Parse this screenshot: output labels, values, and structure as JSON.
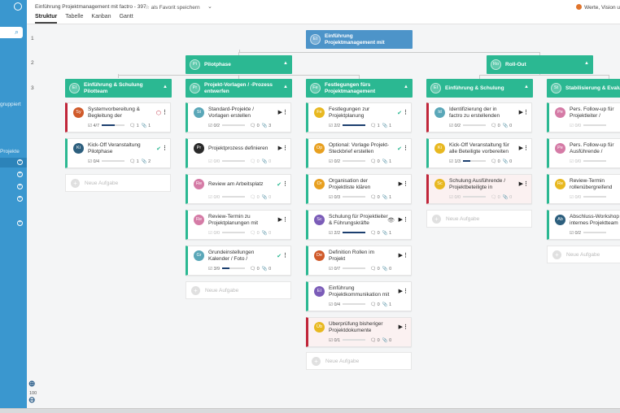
{
  "header": {
    "title": "Einführung Projektmanagement mit factro - 397",
    "favorite_label": "als Favorit speichern",
    "caret": "⌄",
    "tabs": [
      "Struktur",
      "Tabelle",
      "Kanban",
      "Gantt"
    ],
    "user_text": "Werte, Vision u"
  },
  "sidebar": {
    "group_text": "gruppiert",
    "projects_text": "Projekte",
    "zoom_level": "100"
  },
  "rows": [
    "1",
    "2",
    "3"
  ],
  "root": {
    "initials": "EI",
    "label": "Einführung Projektmanagement mit"
  },
  "level2": [
    {
      "initials": "Pi",
      "label": "Pilotphase"
    },
    {
      "initials": "Ro",
      "label": "Roll-Out"
    }
  ],
  "columns": [
    {
      "initials": "EI",
      "label": "Einführung & Schulung Pilotteam"
    },
    {
      "initials": "Pr",
      "label": "Projekt-Vorlagen / -Prozess entwerfen"
    },
    {
      "initials": "Fe",
      "label": "Festlegungen fürs Projektmanagement"
    },
    {
      "initials": "EI",
      "label": "Einführung & Schulung"
    },
    {
      "initials": "St",
      "label": "Stabilisierung & Evalu"
    }
  ],
  "add_task_label": "Neue Aufgabe",
  "colors": {
    "blue": "#4d94c9",
    "green": "#2bb892",
    "red": "#c0263a",
    "sidebar": "#3a97cf"
  },
  "cards": [
    {
      "col": 0,
      "row": 0,
      "av": "Sy",
      "color": "#d05a2a",
      "title": "Systemvorbereitung & Begleitung der",
      "stat": "⬡",
      "stat_color": "#c0263a",
      "play": "",
      "red": true,
      "pink": false,
      "meta": "☑ 4/7",
      "prog": 0.57,
      "c": "1",
      "a": "1",
      "faded": false
    },
    {
      "col": 0,
      "row": 1,
      "av": "Ki",
      "color": "#2d5f7e",
      "title": "Kick-Off Veranstaltung Pilotphase",
      "stat": "✔",
      "stat_color": "#2bb892",
      "play": "",
      "red": false,
      "pink": false,
      "meta": "☑ 0/4",
      "prog": 0,
      "c": "1",
      "a": "2",
      "faded": false
    },
    {
      "col": 1,
      "row": 0,
      "av": "St",
      "color": "#5aa7b8",
      "title": "Standard-Projekte / Vorlagen erstellen",
      "stat": "",
      "stat_color": "",
      "play": "▶",
      "red": false,
      "pink": false,
      "meta": "☑ 0/2",
      "prog": 0,
      "c": "0",
      "a": "3",
      "faded": false
    },
    {
      "col": 1,
      "row": 1,
      "av": "Pr",
      "color": "#2a2a2a",
      "title": "Projektprozess definieren",
      "stat": "",
      "stat_color": "",
      "play": "▶",
      "red": false,
      "pink": false,
      "meta": "☑ 0/0",
      "prog": 0,
      "c": "0",
      "a": "0",
      "faded": true
    },
    {
      "col": 1,
      "row": 2,
      "av": "Re",
      "color": "#d57ba6",
      "title": "Review am Arbeitsplatz",
      "stat": "✔",
      "stat_color": "#2bb892",
      "play": "",
      "red": false,
      "pink": false,
      "meta": "☑ 0/0",
      "prog": 0,
      "c": "0",
      "a": "0",
      "faded": true
    },
    {
      "col": 1,
      "row": 3,
      "av": "Re",
      "color": "#d57ba6",
      "title": "Review-Termin zu Projektplanungen mit",
      "stat": "",
      "stat_color": "",
      "play": "▶",
      "red": false,
      "pink": false,
      "meta": "☑ 0/0",
      "prog": 0,
      "c": "0",
      "a": "0",
      "faded": true
    },
    {
      "col": 1,
      "row": 4,
      "av": "Gr",
      "color": "#5aa7b8",
      "title": "Grundeinstellungen Kalender / Foto /",
      "stat": "✔",
      "stat_color": "#2bb892",
      "play": "",
      "red": false,
      "pink": false,
      "meta": "☑ 3/9",
      "prog": 0.33,
      "c": "0",
      "a": "0",
      "faded": false
    },
    {
      "col": 2,
      "row": 0,
      "av": "Fe",
      "color": "#e8b820",
      "title": "Festlegungen zur Projektplanung",
      "stat": "✔",
      "stat_color": "#2bb892",
      "play": "",
      "red": false,
      "pink": false,
      "meta": "☑ 2/2",
      "prog": 1,
      "c": "1",
      "a": "1",
      "faded": false
    },
    {
      "col": 2,
      "row": 1,
      "av": "Op",
      "color": "#e8a020",
      "title": "Optional: Vorlage Projekt-Steckbrief erstellen",
      "stat": "✔",
      "stat_color": "#2bb892",
      "play": "",
      "red": false,
      "pink": false,
      "meta": "☑ 0/2",
      "prog": 0,
      "c": "0",
      "a": "1",
      "faded": false
    },
    {
      "col": 2,
      "row": 2,
      "av": "Or",
      "color": "#e8a020",
      "title": "Organisation der Projektliste klären",
      "stat": "",
      "stat_color": "",
      "play": "▶",
      "red": false,
      "pink": false,
      "meta": "☑ 0/3",
      "prog": 0,
      "c": "0",
      "a": "1",
      "faded": false
    },
    {
      "col": 2,
      "row": 3,
      "av": "Sc",
      "color": "#7b5cb8",
      "title": "Schulung für Projektleiter & Führungskräfte",
      "stat": "👁",
      "stat_color": "#555",
      "play": "▶",
      "red": false,
      "pink": false,
      "meta": "☑ 2/2",
      "prog": 1,
      "c": "0",
      "a": "1",
      "faded": false
    },
    {
      "col": 2,
      "row": 4,
      "av": "De",
      "color": "#d05a2a",
      "title": "Definition Rollen im Projekt",
      "stat": "",
      "stat_color": "",
      "play": "▶",
      "red": false,
      "pink": false,
      "meta": "☑ 0/7",
      "prog": 0,
      "c": "0",
      "a": "0",
      "faded": false
    },
    {
      "col": 2,
      "row": 5,
      "av": "EI",
      "color": "#7b5cb8",
      "title": "Einführung Projektkommunikation mit",
      "stat": "",
      "stat_color": "",
      "play": "▶",
      "red": false,
      "pink": false,
      "meta": "☑ 0/4",
      "prog": 0,
      "c": "0",
      "a": "1",
      "faded": false
    },
    {
      "col": 2,
      "row": 6,
      "av": "Üb",
      "color": "#e8b820",
      "title": "Überprüfung bisheriger Projektdokumente",
      "stat": "",
      "stat_color": "",
      "play": "▶",
      "red": true,
      "pink": true,
      "meta": "☑ 0/1",
      "prog": 0,
      "c": "0",
      "a": "0",
      "faded": false
    },
    {
      "col": 3,
      "row": 0,
      "av": "Id",
      "color": "#5aa7b8",
      "title": "Identifizierung der in factro zu erstellenden Projekte",
      "stat": "",
      "stat_color": "",
      "play": "▶",
      "red": true,
      "pink": false,
      "meta": "☑ 0/2",
      "prog": 0,
      "c": "0",
      "a": "0",
      "faded": false
    },
    {
      "col": 3,
      "row": 1,
      "av": "Ki",
      "color": "#e8b820",
      "title": "Kick-Off Veranstaltung für alle Beteiligte vorbereiten",
      "stat": "",
      "stat_color": "",
      "play": "▶",
      "red": false,
      "pink": false,
      "meta": "☑ 1/3",
      "prog": 0.33,
      "c": "0",
      "a": "0",
      "faded": false
    },
    {
      "col": 3,
      "row": 2,
      "av": "Sc",
      "color": "#e8b820",
      "title": "Schulung Ausführende / Projektbeteiligte in",
      "stat": "",
      "stat_color": "",
      "play": "▶",
      "red": true,
      "pink": true,
      "meta": "☑ 0/0",
      "prog": 0,
      "c": "0",
      "a": "0",
      "faded": true
    },
    {
      "col": 4,
      "row": 0,
      "av": "Pe",
      "color": "#d57ba6",
      "title": "Pers. Follow-up für Projektleiter /",
      "stat": "",
      "stat_color": "",
      "play": "",
      "red": false,
      "pink": false,
      "meta": "☑ 0/0",
      "prog": 0,
      "c": "",
      "a": "",
      "faded": true
    },
    {
      "col": 4,
      "row": 1,
      "av": "Pe",
      "color": "#d57ba6",
      "title": "Pers. Follow-up für Ausführende /",
      "stat": "",
      "stat_color": "",
      "play": "",
      "red": false,
      "pink": false,
      "meta": "☑ 0/0",
      "prog": 0,
      "c": "",
      "a": "",
      "faded": true
    },
    {
      "col": 4,
      "row": 2,
      "av": "Re",
      "color": "#e8b820",
      "title": "Review-Termin rollenübergreifend",
      "stat": "",
      "stat_color": "",
      "play": "",
      "red": false,
      "pink": false,
      "meta": "☑ 0/0",
      "prog": 0,
      "c": "",
      "a": "",
      "faded": true
    },
    {
      "col": 4,
      "row": 3,
      "av": "Ab",
      "color": "#2d5f7e",
      "title": "Abschluss-Workshop internes Projektteam",
      "stat": "",
      "stat_color": "",
      "play": "",
      "red": false,
      "pink": false,
      "meta": "☑ 0/2",
      "prog": 0,
      "c": "",
      "a": "",
      "faded": false
    }
  ]
}
